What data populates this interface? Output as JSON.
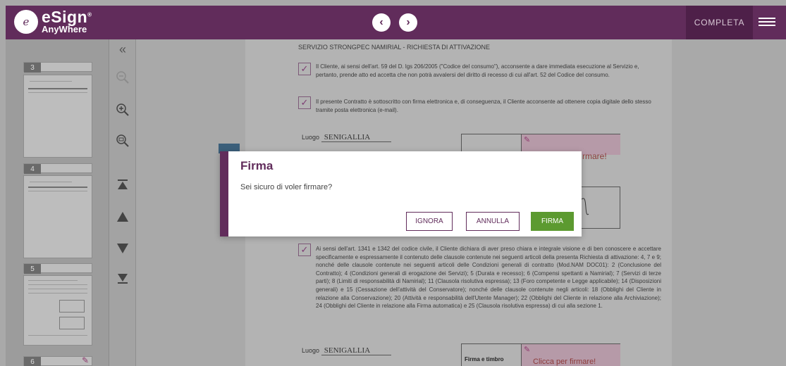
{
  "header": {
    "logo_mark": "e",
    "logo_brand": "eSign",
    "logo_sub": "AnyWhere",
    "logo_registered": "®",
    "prev_label": "‹",
    "next_label": "›",
    "complete_label": "COMPLETA"
  },
  "thumbnails": [
    {
      "page": "3"
    },
    {
      "page": "4"
    },
    {
      "page": "5"
    },
    {
      "page": "6"
    }
  ],
  "document": {
    "heading": "SERVIZIO STRONGPEC NAMIRIAL - RICHIESTA DI ATTIVAZIONE",
    "clause1": "Il Cliente, ai sensi dell'art. 59 del D. lgs 206/2005 (\"Codice del consumo\"), acconsente a dare immediata esecuzione al Servizio e, pertanto, prende atto ed accetta che non potrà avvalersi del diritto di recesso di cui all'art. 52 del Codice del consumo.",
    "clause2": "Il presente Contratto è sottoscritto con firma elettronica e, di conseguenza, il Cliente acconsente ad ottenere copia digitale dello stesso tramite posta elettronica (e-mail).",
    "clause3": "Ai sensi dell'art. 1341 e 1342 del codice civile, il Cliente dichiara di aver preso chiara e integrale visione e di ben conoscere e accettare specificamente e espressamente il contenuto delle clausole contenute nei seguenti articoli della presenta Richiesta di attivazione: 4, 7 e 9; nonché delle clausole contenute nei seguenti articoli delle Condizioni generali di contratto (Mod.NAM DOC01): 2 (Conclusione del Contratto); 4 (Condizioni generali di erogazione dei Servizi); 5 (Durata e recesso); 6 (Compensi spettanti a Namirial); 7 (Servizi di terze parti); 8 (Limiti di responsabilità di Namirial); 11 (Clausola risolutiva espressa); 13 (Foro competente e Legge applicabile); 14 (Disposizioni generali) e 15 (Cessazione dell'attività del Conservatore); nonché delle clausole contenute negli articoli: 18 (Obblighi del Cliente in relazione alla Conservazione); 20 (Attività e responsabilità dell'Utente Manager); 22 (Obblighi del Cliente in relazione alla Archiviazione); 24 (Obblighi del Cliente in relazione alla Firma automatica) e 25 (Clausola risolutiva espressa) di cui alla sezione 1.",
    "place_label": "Luogo",
    "place_value": "SENIGALLIA",
    "sig_label": "Firma e timbro",
    "sig_prompt_partial": "rmare!",
    "sig_prompt": "Clicca per firmare!"
  },
  "dialog": {
    "title": "Firma",
    "message": "Sei sicuro di voler firmare?",
    "ignore_label": "IGNORA",
    "cancel_label": "ANNULLA",
    "sign_label": "FIRMA"
  }
}
